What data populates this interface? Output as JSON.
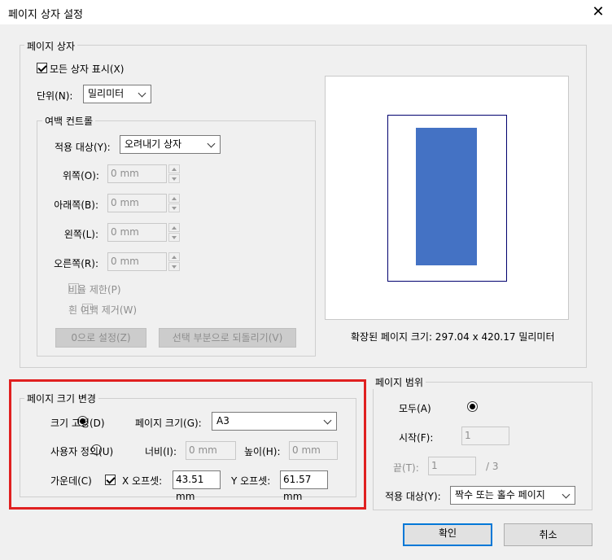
{
  "window": {
    "title": "페이지 상자 설정",
    "close_glyph": "✕"
  },
  "page_boxes": {
    "legend": "페이지 상자",
    "show_all_label": "모든 상자 표시(X)",
    "unit_label": "단위(N):",
    "unit_value": "밀리미터",
    "margin_controls": {
      "legend": "여백 컨트롤",
      "apply_to_label": "적용 대상(Y):",
      "apply_to_value": "오려내기 상자",
      "top_label": "위쪽(O):",
      "top_value": "0 mm",
      "bottom_label": "아래쪽(B):",
      "bottom_value": "0 mm",
      "left_label": "왼쪽(L):",
      "left_value": "0 mm",
      "right_label": "오른쪽(R):",
      "right_value": "0 mm",
      "constrain_label": "비율 제한(P)",
      "remove_white_label": "흰 여백 제거(W)",
      "set_zero_label": "0으로 설정(Z)",
      "revert_label": "선택 부분으로 되돌리기(V)"
    },
    "expanded_size_text": "확장된 페이지 크기: 297.04 x 420.17 밀리미터"
  },
  "change_page_size": {
    "legend": "페이지 크기 변경",
    "fixed_label": "크기 고정(D)",
    "page_size_label": "페이지 크기(G):",
    "page_size_value": "A3",
    "custom_label": "사용자 정의(U)",
    "width_label": "너비(I):",
    "width_value": "0 mm",
    "height_label": "높이(H):",
    "height_value": "0 mm",
    "center_label": "가운데(C)",
    "x_offset_label": "X 오프셋:",
    "x_offset_value": "43.51 mm",
    "y_offset_label": "Y 오프셋:",
    "y_offset_value": "61.57 mm"
  },
  "page_range": {
    "legend": "페이지 범위",
    "all_label": "모두(A)",
    "from_label": "시작(F):",
    "from_value": "1",
    "to_label": "끝(T):",
    "to_value": "1",
    "of_total": "/ 3",
    "apply_to_label": "적용 대상(Y):",
    "apply_to_value": "짝수 또는 홀수 페이지"
  },
  "footer": {
    "ok_label": "확인",
    "cancel_label": "취소"
  },
  "colors": {
    "accent": "#0078d7",
    "highlight": "#e02020",
    "page_fill": "#4472c4",
    "outline": "#00006e"
  }
}
